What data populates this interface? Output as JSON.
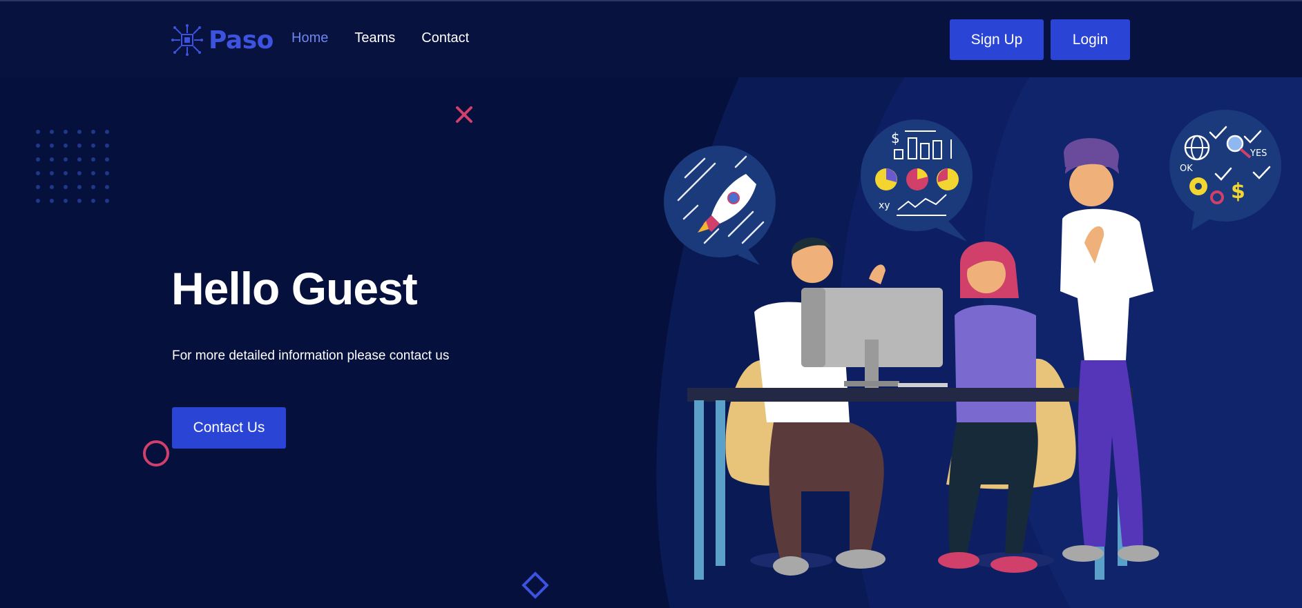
{
  "nav": {
    "logo_text": "Paso",
    "links": [
      {
        "label": "Home",
        "active": true
      },
      {
        "label": "Teams",
        "active": false
      },
      {
        "label": "Contact",
        "active": false
      }
    ],
    "signup_label": "Sign Up",
    "login_label": "Login"
  },
  "hero": {
    "title": "Hello Guest",
    "subtitle": "For more detailed information please contact us",
    "cta_label": "Contact Us"
  },
  "illustration": {
    "bubble_ok": "OK",
    "bubble_yes": "YES",
    "bubble_dollar": "$",
    "bubble_xy": "xy"
  },
  "colors": {
    "background": "#06103d",
    "navbar": "#07123f",
    "accent": "#2a44d6",
    "nav_active": "#6e86f0",
    "decor_pink": "#d0406a",
    "decor_blue": "#3d53df"
  }
}
